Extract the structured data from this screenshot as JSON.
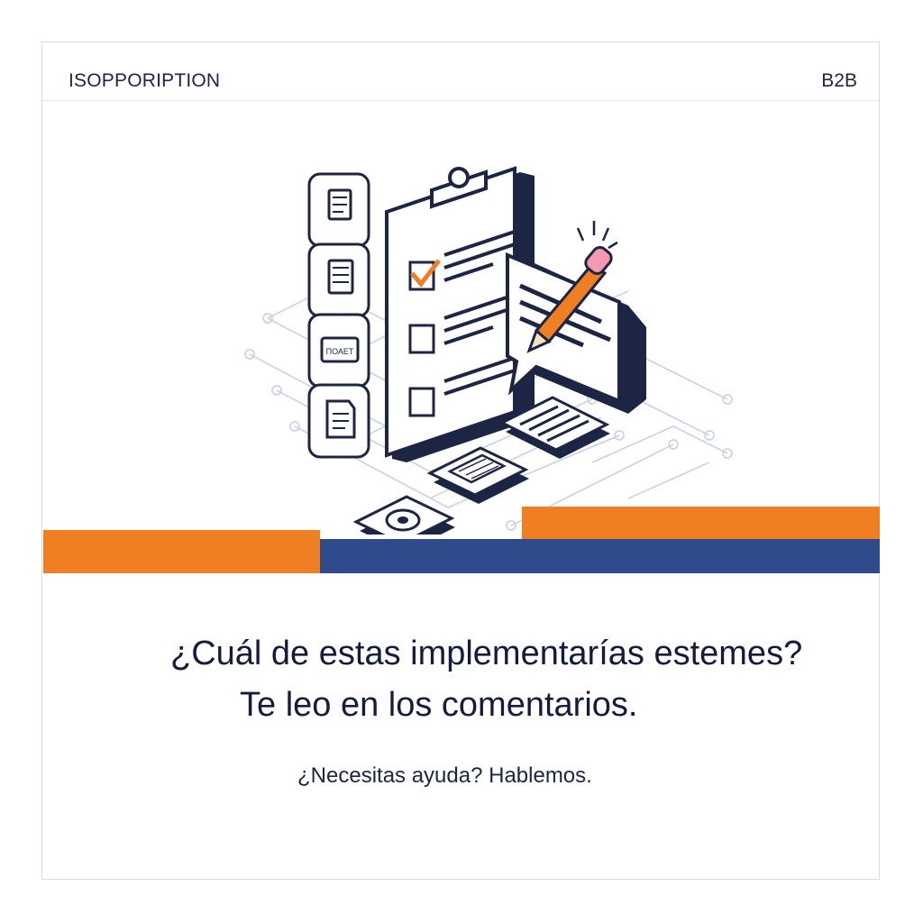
{
  "header": {
    "brand": "ISOPPORIPTION",
    "tag": "B2B"
  },
  "illustration": {
    "icons": [
      "clipboard-checklist-icon",
      "pencil-icon",
      "speech-bubble-icon",
      "document-icon",
      "monitor-icon",
      "camera-icon",
      "ticket-icon"
    ],
    "ticket_label": "ПОАЕТ"
  },
  "colors": {
    "orange": "#f07e22",
    "blue": "#2f4b8c",
    "navy": "#1c2543"
  },
  "main": {
    "question": "¿Cuál de estas implementarías estemes?",
    "cta": "Te leo en los comentarios.",
    "help": "¿Necesitas ayuda? Hablemos."
  }
}
